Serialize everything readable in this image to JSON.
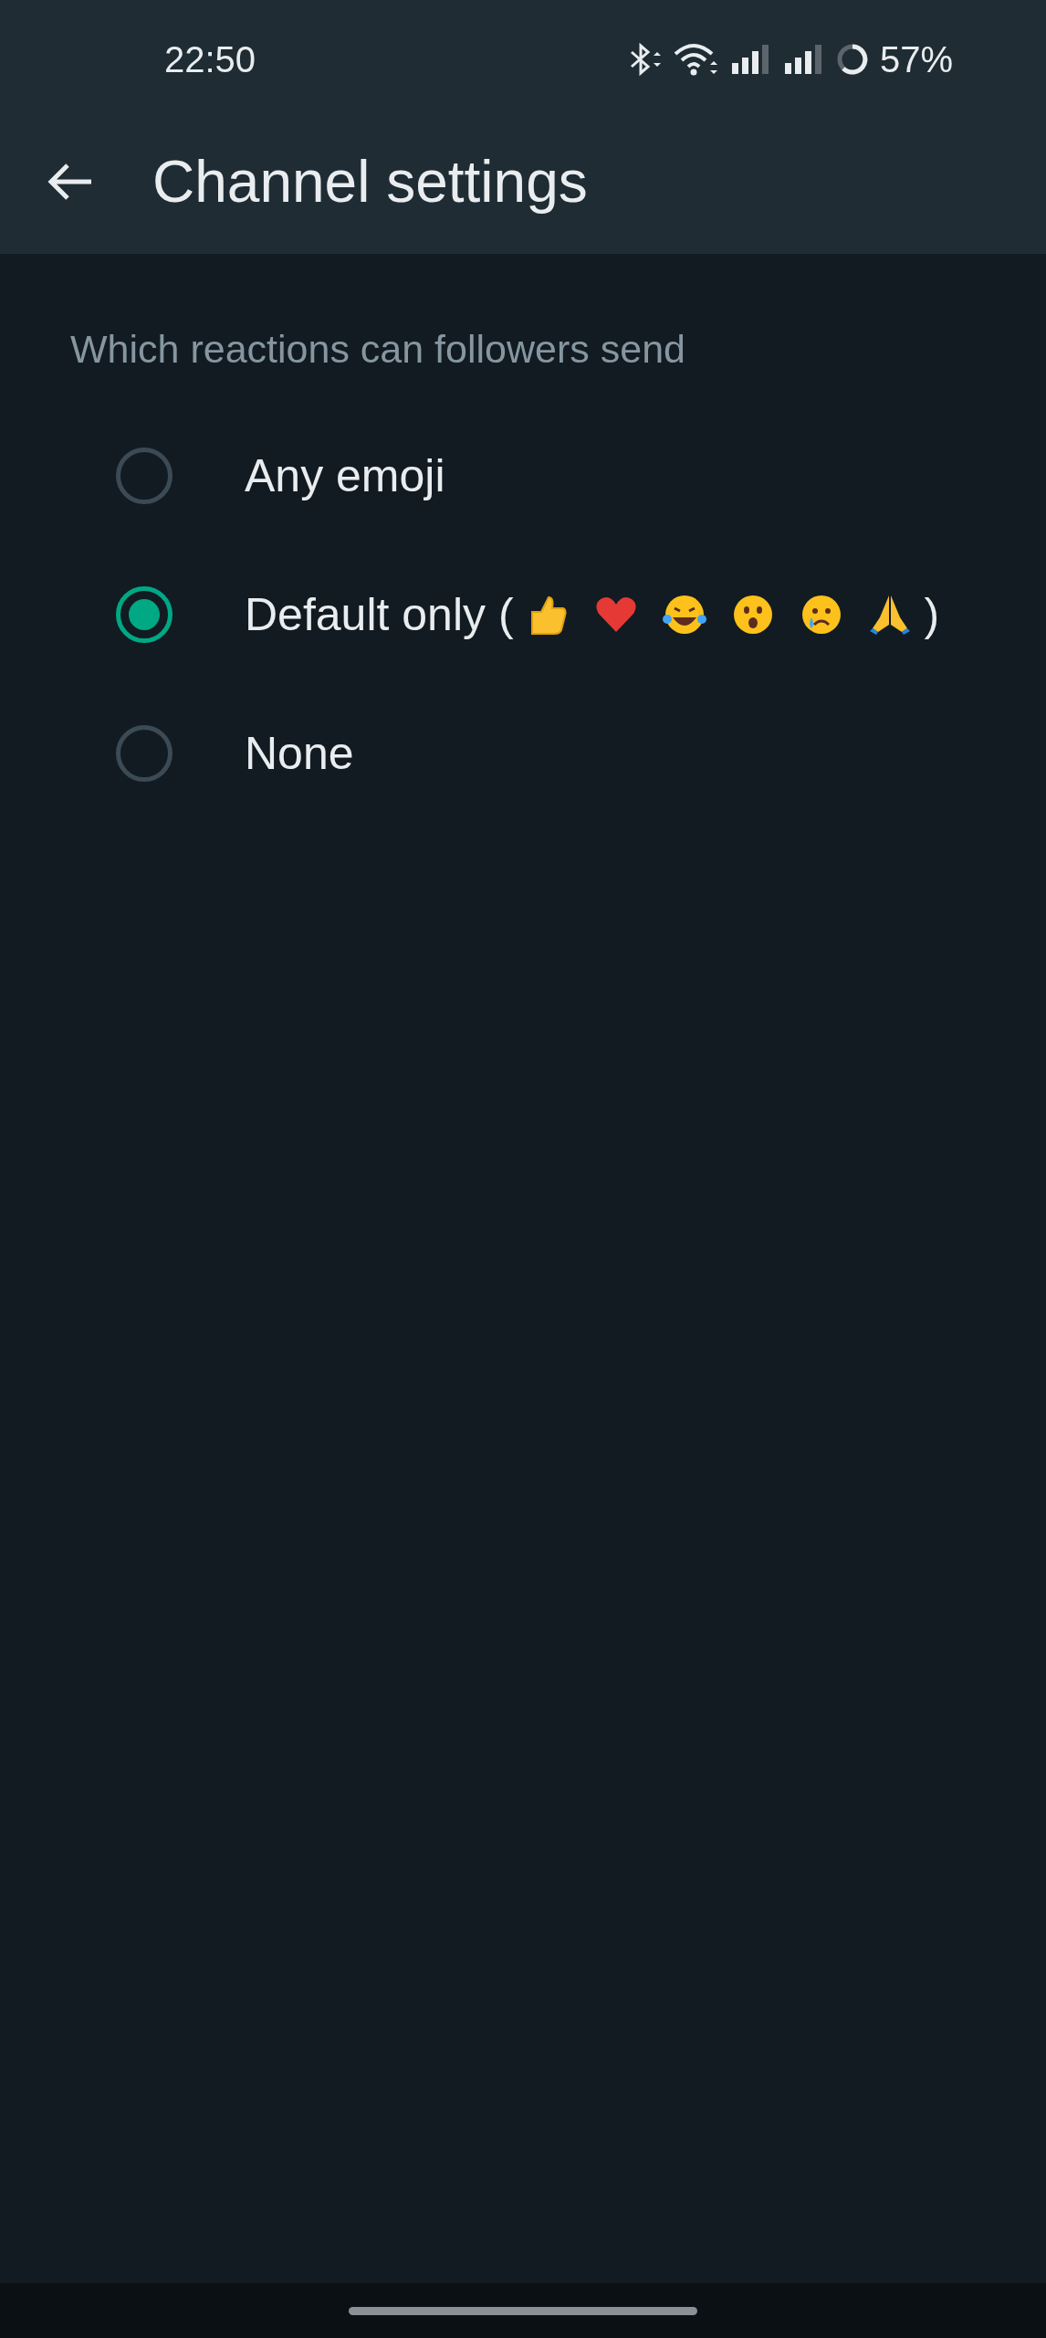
{
  "status_bar": {
    "time": "22:50",
    "battery": "57%"
  },
  "header": {
    "title": "Channel settings"
  },
  "section": {
    "heading": "Which reactions can followers send"
  },
  "options": [
    {
      "label": "Any emoji",
      "kind": "plain",
      "selected": false
    },
    {
      "label": "Default only (",
      "suffix": ")",
      "kind": "reactions",
      "selected": true
    },
    {
      "label": "None",
      "kind": "plain",
      "selected": false
    }
  ]
}
